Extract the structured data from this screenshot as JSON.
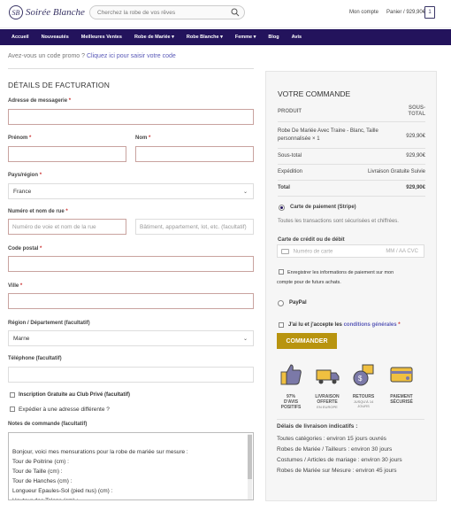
{
  "header": {
    "logo": "Soirée Blanche",
    "search_placeholder": "Cherchez la robe de vos rêves",
    "account": "Mon compte",
    "cart": "Panier / 929,90€",
    "cart_count": "1"
  },
  "nav": [
    "Accueil",
    "Nouveautés",
    "Meilleures Ventes",
    "Robe de Mariée ▾",
    "Robe Blanche ▾",
    "Femme ▾",
    "Blog",
    "Avis"
  ],
  "promo": {
    "text": "Avez-vous un code promo ?",
    "link": "Cliquez ici pour saisir votre code"
  },
  "billing": {
    "title": "DÉTAILS DE FACTURATION",
    "email_label": "Adresse de messagerie",
    "firstname_label": "Prénom",
    "lastname_label": "Nom",
    "country_label": "Pays/région",
    "country_value": "France",
    "street_label": "Numéro et nom de rue",
    "street_placeholder": "Numéro de voie et nom de la rue",
    "street2_placeholder": "Bâtiment, appartement, lot, etc. (facultatif)",
    "postcode_label": "Code postal",
    "city_label": "Ville",
    "region_label": "Région / Département (facultatif)",
    "region_value": "Marne",
    "phone_label": "Téléphone (facultatif)",
    "club_label": "Inscription Gratuite au Club Privé (facultatif)",
    "ship_diff_label": "Expédier à une adresse différente ?",
    "notes_label": "Notes de commande (facultatif)",
    "notes_value": "Bonjour, voici mes mensurations pour la robe de mariée sur mesure :\nTour de Poitrine (cm) :\nTour de Taille (cm) :\nTour de Hanches (cm) :\nLongueur Epaules-Sol (pied nus) (cm) :\nHauteur des Talons (cm) :"
  },
  "order": {
    "title": "VOTRE COMMANDE",
    "col_product": "PRODUIT",
    "col_subtotal_1": "SOUS-",
    "col_subtotal_2": "TOTAL",
    "item_name_1": "Robe De Mariée Avec Traine - Blanc, Taille",
    "item_name_2": "personnalisée × 1",
    "item_price": "929,90€",
    "subtotal_label": "Sous-total",
    "subtotal_value": "929,90€",
    "shipping_label": "Expédition",
    "shipping_value": "Livraison Gratuite Suivie",
    "total_label": "Total",
    "total_value": "929,90€",
    "stripe_label": "Carte de paiement (Stripe)",
    "stripe_note": "Toutes les transactions sont sécurisées et chiffrées.",
    "card_label": "Carte de crédit ou de débit",
    "card_number_placeholder": "Numéro de carte",
    "card_expiry_placeholder": "MM / AA  CVC",
    "save_info_1": "Enregistrer les informations de paiement sur mon",
    "save_info_2": "compte pour de futurs achats.",
    "paypal_label": "PayPal",
    "terms_prefix": "J'ai lu et j'accepte les",
    "terms_link": "conditions générales",
    "terms_req": "*",
    "order_button": "COMMANDER",
    "features": [
      {
        "l1": "97%",
        "l2": "D'AVIS",
        "l3": "POSITIFS",
        "sub": ""
      },
      {
        "l1": "LIVRAISON",
        "l2": "OFFERTE",
        "l3": "",
        "sub": "EN EUROPE"
      },
      {
        "l1": "RETOURS",
        "l2": "",
        "l3": "",
        "sub": "JUSQU'À 14 JOURS"
      },
      {
        "l1": "PAIEMENT",
        "l2": "SÉCURISÉ",
        "l3": "",
        "sub": ""
      }
    ],
    "delivery_title": "Délais de livraison indicatifs :",
    "delivery_lines": [
      "Toutes catégories : environ 15 jours ouvrés",
      "Robes de Mariée / Tailleurs : environ 30 jours",
      "Costumes / Articles de mariage : environ 30 jours",
      "Robes de Mariée sur Mesure : environ 45 jours"
    ]
  },
  "colors": {
    "nav_bg": "#23135c",
    "accent_button": "#b8940f",
    "link": "#5a5ab8"
  }
}
